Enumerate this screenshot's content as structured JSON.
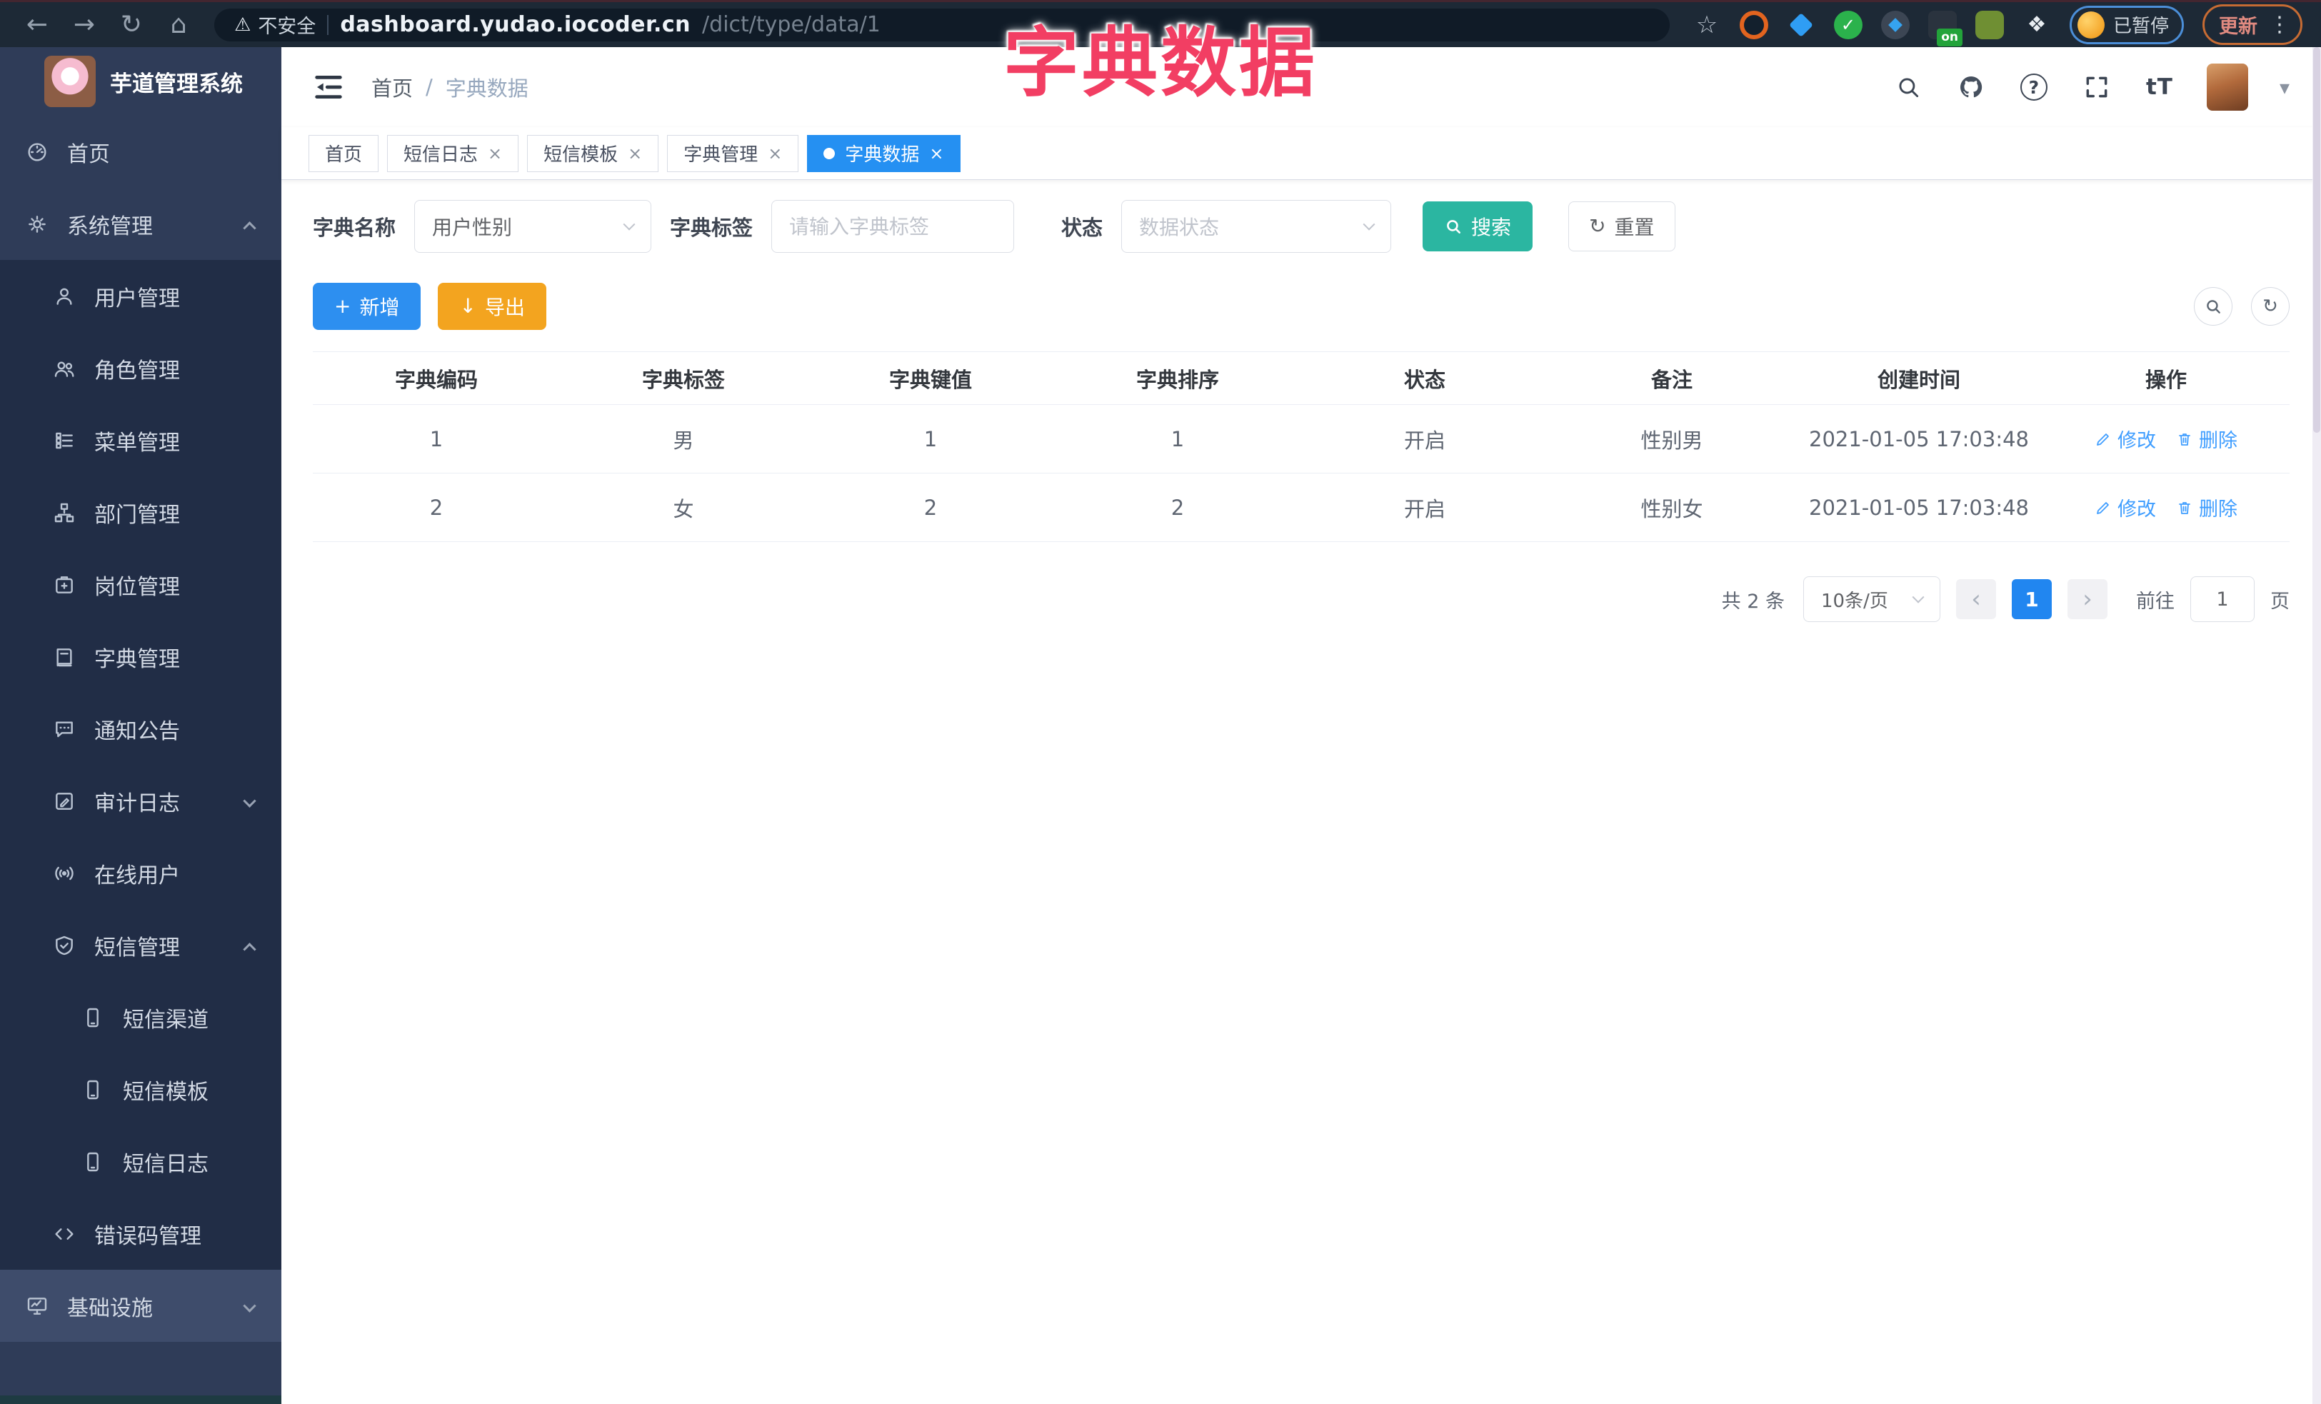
{
  "browser": {
    "security": "不安全",
    "url_host": "dashboard.yudao.iocoder.cn",
    "url_path": "/dict/type/data/1",
    "ext_on": "on",
    "paused": "已暂停",
    "update": "更新"
  },
  "overlay": {
    "title": "字典数据"
  },
  "sidebar": {
    "logo_title": "芋道管理系统",
    "items": [
      {
        "label": "首页"
      },
      {
        "label": "系统管理"
      },
      {
        "label": "用户管理"
      },
      {
        "label": "角色管理"
      },
      {
        "label": "菜单管理"
      },
      {
        "label": "部门管理"
      },
      {
        "label": "岗位管理"
      },
      {
        "label": "字典管理"
      },
      {
        "label": "通知公告"
      },
      {
        "label": "审计日志"
      },
      {
        "label": "在线用户"
      },
      {
        "label": "短信管理"
      },
      {
        "label": "短信渠道"
      },
      {
        "label": "短信模板"
      },
      {
        "label": "短信日志"
      },
      {
        "label": "错误码管理"
      },
      {
        "label": "基础设施"
      }
    ]
  },
  "header": {
    "breadcrumb_home": "首页",
    "breadcrumb_sep": "/",
    "breadcrumb_current": "字典数据",
    "font_icon": "tT"
  },
  "tabs": [
    {
      "label": "首页"
    },
    {
      "label": "短信日志"
    },
    {
      "label": "短信模板"
    },
    {
      "label": "字典管理"
    },
    {
      "label": "字典数据"
    }
  ],
  "filters": {
    "name_label": "字典名称",
    "name_value": "用户性别",
    "tag_label": "字典标签",
    "tag_placeholder": "请输入字典标签",
    "status_label": "状态",
    "status_placeholder": "数据状态",
    "search": "搜索",
    "reset": "重置"
  },
  "toolbar": {
    "add": "新增",
    "export": "导出"
  },
  "table": {
    "headers": [
      "字典编码",
      "字典标签",
      "字典键值",
      "字典排序",
      "状态",
      "备注",
      "创建时间",
      "操作"
    ],
    "rows": [
      {
        "cells": [
          "1",
          "男",
          "1",
          "1",
          "开启",
          "性别男",
          "2021-01-05 17:03:48"
        ]
      },
      {
        "cells": [
          "2",
          "女",
          "2",
          "2",
          "开启",
          "性别女",
          "2021-01-05 17:03:48"
        ]
      }
    ],
    "edit": "修改",
    "delete": "删除"
  },
  "pagination": {
    "total": "共 2 条",
    "size": "10条/页",
    "page": "1",
    "goto": "前往",
    "goto_value": "1",
    "unit": "页"
  }
}
